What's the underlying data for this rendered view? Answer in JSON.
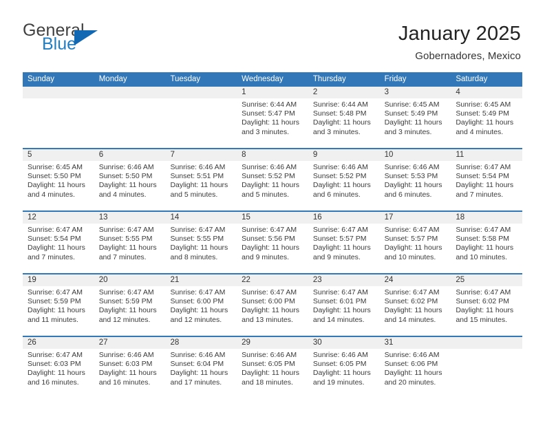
{
  "brand": {
    "name_top": "General",
    "name_bottom": "Blue",
    "accent_color": "#1268b3",
    "text_color": "#404040"
  },
  "header": {
    "title": "January 2025",
    "subtitle": "Gobernadores, Mexico"
  },
  "theme": {
    "header_blue": "#3278b8",
    "daynum_band": "#f0f0f0",
    "body_text": "#3a3a3a"
  },
  "weekdays": [
    "Sunday",
    "Monday",
    "Tuesday",
    "Wednesday",
    "Thursday",
    "Friday",
    "Saturday"
  ],
  "weeks": [
    [
      {
        "day": "",
        "empty": true
      },
      {
        "day": "",
        "empty": true
      },
      {
        "day": "",
        "empty": true
      },
      {
        "day": "1",
        "sunrise": "Sunrise: 6:44 AM",
        "sunset": "Sunset: 5:47 PM",
        "daylight1": "Daylight: 11 hours",
        "daylight2": "and 3 minutes."
      },
      {
        "day": "2",
        "sunrise": "Sunrise: 6:44 AM",
        "sunset": "Sunset: 5:48 PM",
        "daylight1": "Daylight: 11 hours",
        "daylight2": "and 3 minutes."
      },
      {
        "day": "3",
        "sunrise": "Sunrise: 6:45 AM",
        "sunset": "Sunset: 5:49 PM",
        "daylight1": "Daylight: 11 hours",
        "daylight2": "and 3 minutes."
      },
      {
        "day": "4",
        "sunrise": "Sunrise: 6:45 AM",
        "sunset": "Sunset: 5:49 PM",
        "daylight1": "Daylight: 11 hours",
        "daylight2": "and 4 minutes."
      }
    ],
    [
      {
        "day": "5",
        "sunrise": "Sunrise: 6:45 AM",
        "sunset": "Sunset: 5:50 PM",
        "daylight1": "Daylight: 11 hours",
        "daylight2": "and 4 minutes."
      },
      {
        "day": "6",
        "sunrise": "Sunrise: 6:46 AM",
        "sunset": "Sunset: 5:50 PM",
        "daylight1": "Daylight: 11 hours",
        "daylight2": "and 4 minutes."
      },
      {
        "day": "7",
        "sunrise": "Sunrise: 6:46 AM",
        "sunset": "Sunset: 5:51 PM",
        "daylight1": "Daylight: 11 hours",
        "daylight2": "and 5 minutes."
      },
      {
        "day": "8",
        "sunrise": "Sunrise: 6:46 AM",
        "sunset": "Sunset: 5:52 PM",
        "daylight1": "Daylight: 11 hours",
        "daylight2": "and 5 minutes."
      },
      {
        "day": "9",
        "sunrise": "Sunrise: 6:46 AM",
        "sunset": "Sunset: 5:52 PM",
        "daylight1": "Daylight: 11 hours",
        "daylight2": "and 6 minutes."
      },
      {
        "day": "10",
        "sunrise": "Sunrise: 6:46 AM",
        "sunset": "Sunset: 5:53 PM",
        "daylight1": "Daylight: 11 hours",
        "daylight2": "and 6 minutes."
      },
      {
        "day": "11",
        "sunrise": "Sunrise: 6:47 AM",
        "sunset": "Sunset: 5:54 PM",
        "daylight1": "Daylight: 11 hours",
        "daylight2": "and 7 minutes."
      }
    ],
    [
      {
        "day": "12",
        "sunrise": "Sunrise: 6:47 AM",
        "sunset": "Sunset: 5:54 PM",
        "daylight1": "Daylight: 11 hours",
        "daylight2": "and 7 minutes."
      },
      {
        "day": "13",
        "sunrise": "Sunrise: 6:47 AM",
        "sunset": "Sunset: 5:55 PM",
        "daylight1": "Daylight: 11 hours",
        "daylight2": "and 7 minutes."
      },
      {
        "day": "14",
        "sunrise": "Sunrise: 6:47 AM",
        "sunset": "Sunset: 5:55 PM",
        "daylight1": "Daylight: 11 hours",
        "daylight2": "and 8 minutes."
      },
      {
        "day": "15",
        "sunrise": "Sunrise: 6:47 AM",
        "sunset": "Sunset: 5:56 PM",
        "daylight1": "Daylight: 11 hours",
        "daylight2": "and 9 minutes."
      },
      {
        "day": "16",
        "sunrise": "Sunrise: 6:47 AM",
        "sunset": "Sunset: 5:57 PM",
        "daylight1": "Daylight: 11 hours",
        "daylight2": "and 9 minutes."
      },
      {
        "day": "17",
        "sunrise": "Sunrise: 6:47 AM",
        "sunset": "Sunset: 5:57 PM",
        "daylight1": "Daylight: 11 hours",
        "daylight2": "and 10 minutes."
      },
      {
        "day": "18",
        "sunrise": "Sunrise: 6:47 AM",
        "sunset": "Sunset: 5:58 PM",
        "daylight1": "Daylight: 11 hours",
        "daylight2": "and 10 minutes."
      }
    ],
    [
      {
        "day": "19",
        "sunrise": "Sunrise: 6:47 AM",
        "sunset": "Sunset: 5:59 PM",
        "daylight1": "Daylight: 11 hours",
        "daylight2": "and 11 minutes."
      },
      {
        "day": "20",
        "sunrise": "Sunrise: 6:47 AM",
        "sunset": "Sunset: 5:59 PM",
        "daylight1": "Daylight: 11 hours",
        "daylight2": "and 12 minutes."
      },
      {
        "day": "21",
        "sunrise": "Sunrise: 6:47 AM",
        "sunset": "Sunset: 6:00 PM",
        "daylight1": "Daylight: 11 hours",
        "daylight2": "and 12 minutes."
      },
      {
        "day": "22",
        "sunrise": "Sunrise: 6:47 AM",
        "sunset": "Sunset: 6:00 PM",
        "daylight1": "Daylight: 11 hours",
        "daylight2": "and 13 minutes."
      },
      {
        "day": "23",
        "sunrise": "Sunrise: 6:47 AM",
        "sunset": "Sunset: 6:01 PM",
        "daylight1": "Daylight: 11 hours",
        "daylight2": "and 14 minutes."
      },
      {
        "day": "24",
        "sunrise": "Sunrise: 6:47 AM",
        "sunset": "Sunset: 6:02 PM",
        "daylight1": "Daylight: 11 hours",
        "daylight2": "and 14 minutes."
      },
      {
        "day": "25",
        "sunrise": "Sunrise: 6:47 AM",
        "sunset": "Sunset: 6:02 PM",
        "daylight1": "Daylight: 11 hours",
        "daylight2": "and 15 minutes."
      }
    ],
    [
      {
        "day": "26",
        "sunrise": "Sunrise: 6:47 AM",
        "sunset": "Sunset: 6:03 PM",
        "daylight1": "Daylight: 11 hours",
        "daylight2": "and 16 minutes."
      },
      {
        "day": "27",
        "sunrise": "Sunrise: 6:46 AM",
        "sunset": "Sunset: 6:03 PM",
        "daylight1": "Daylight: 11 hours",
        "daylight2": "and 16 minutes."
      },
      {
        "day": "28",
        "sunrise": "Sunrise: 6:46 AM",
        "sunset": "Sunset: 6:04 PM",
        "daylight1": "Daylight: 11 hours",
        "daylight2": "and 17 minutes."
      },
      {
        "day": "29",
        "sunrise": "Sunrise: 6:46 AM",
        "sunset": "Sunset: 6:05 PM",
        "daylight1": "Daylight: 11 hours",
        "daylight2": "and 18 minutes."
      },
      {
        "day": "30",
        "sunrise": "Sunrise: 6:46 AM",
        "sunset": "Sunset: 6:05 PM",
        "daylight1": "Daylight: 11 hours",
        "daylight2": "and 19 minutes."
      },
      {
        "day": "31",
        "sunrise": "Sunrise: 6:46 AM",
        "sunset": "Sunset: 6:06 PM",
        "daylight1": "Daylight: 11 hours",
        "daylight2": "and 20 minutes."
      },
      {
        "day": "",
        "empty": true
      }
    ]
  ]
}
